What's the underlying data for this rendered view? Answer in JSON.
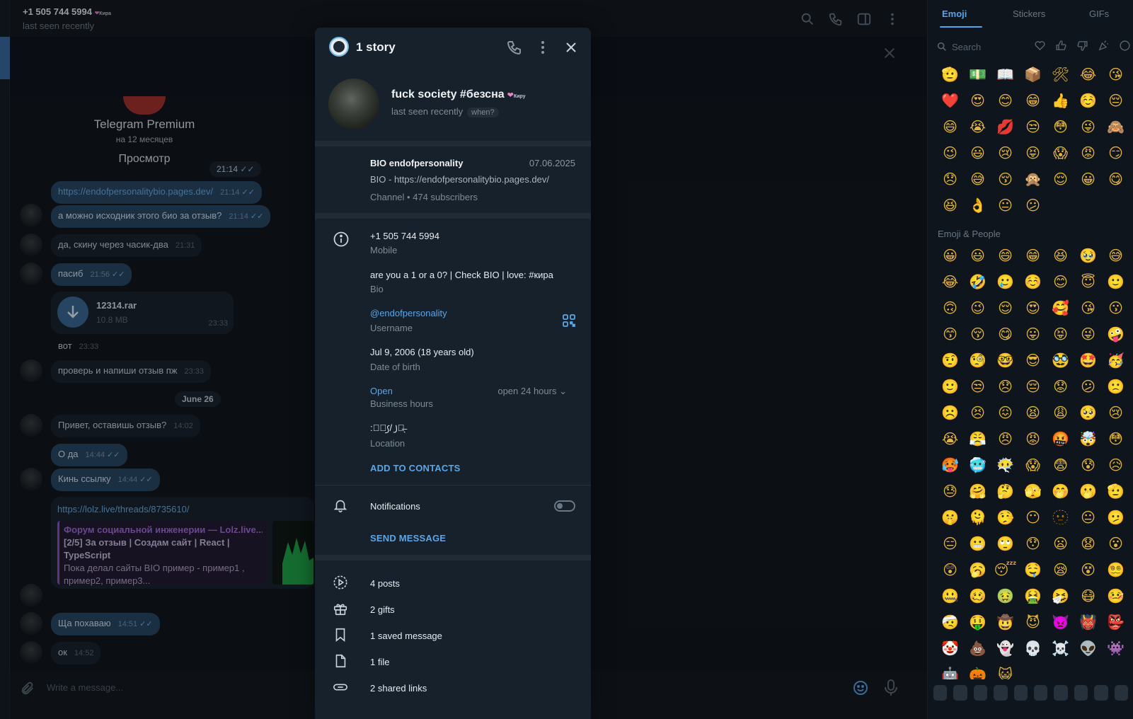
{
  "chat_header": {
    "name": "+1 505 744 5994",
    "heart_text": "Кира",
    "status": "last seen recently"
  },
  "premium": {
    "title": "Telegram Premium",
    "duration": "на 12 месяцев",
    "view": "Просмотр",
    "time": "21:14"
  },
  "messages": [
    {
      "text": "https://endofpersonalitybio.pages.dev/",
      "time": "21:14",
      "dir": "out"
    },
    {
      "text": "а можно исходник этого био за отзыв?",
      "time": "21:14",
      "dir": "out"
    },
    {
      "text": "да, скину через часик-два",
      "time": "21:31",
      "dir": "in"
    },
    {
      "text": "пасиб",
      "time": "21:56",
      "dir": "out"
    },
    {
      "text": "вот",
      "time": "23:33",
      "dir": "in"
    },
    {
      "text": "проверь и напиши отзыв пж",
      "time": "23:33",
      "dir": "in"
    },
    {
      "text": "Привет, оставишь отзыв?",
      "time": "14:02",
      "dir": "in"
    },
    {
      "text": "О да",
      "time": "14:44",
      "dir": "out"
    },
    {
      "text": "Кинь ссылку",
      "time": "14:44",
      "dir": "out"
    },
    {
      "text": "Ща похаваю",
      "time": "14:51",
      "dir": "out"
    },
    {
      "text": "ок",
      "time": "14:52",
      "dir": "in"
    }
  ],
  "file": {
    "name": "12314.rar",
    "size": "10.8 MB",
    "time": "23:33"
  },
  "date_separator": "June 26",
  "link_card": {
    "url": "https://lolz.live/threads/8735610/",
    "title": "Форум социальной инженерии — Lolz.live...",
    "desc_bold": "[2/5] За отзыв | Создам сайт | React | TypeScript",
    "desc": "Пока делал сайты BIO пример - пример1 , пример2, пример3..."
  },
  "composer": {
    "placeholder": "Write a message..."
  },
  "emoji_panel": {
    "tabs": [
      "Emoji",
      "Stickers",
      "GIFs"
    ],
    "search_placeholder": "Search",
    "section": "Emoji & People",
    "recent": [
      "🫡",
      "💵",
      "📖",
      "📦",
      "🛠",
      "😂",
      "😘",
      "❤️",
      "😍",
      "😊",
      "😁",
      "👍",
      "☺️",
      "😔",
      "😄",
      "😭",
      "💋",
      "😒",
      "😳",
      "😜",
      "🙈",
      "😉",
      "😃",
      "😢",
      "😝",
      "😱",
      "😡",
      "😏",
      "😞",
      "😅",
      "😚",
      "🙊",
      "😌",
      "😀",
      "😋",
      "😆",
      "👌",
      "😐",
      "😕"
    ],
    "people": [
      "😀",
      "😃",
      "😄",
      "😁",
      "😆",
      "🥹",
      "😅",
      "😂",
      "🤣",
      "🥲",
      "☺️",
      "😊",
      "😇",
      "🙂",
      "🙃",
      "😉",
      "😌",
      "😍",
      "🥰",
      "😘",
      "😗",
      "😙",
      "😚",
      "😋",
      "😛",
      "😝",
      "😜",
      "🤪",
      "🤨",
      "🧐",
      "🤓",
      "😎",
      "🥸",
      "🤩",
      "🥳",
      "🙂",
      "😒",
      "😞",
      "😔",
      "😟",
      "😕",
      "🙁",
      "☹️",
      "😣",
      "😖",
      "😫",
      "😩",
      "🥺",
      "😢",
      "😭",
      "😤",
      "😠",
      "😡",
      "🤬",
      "🤯",
      "😳",
      "🥵",
      "🥶",
      "😶‍🌫️",
      "😱",
      "😨",
      "😰",
      "😥",
      "😓",
      "🤗",
      "🤔",
      "🫣",
      "🤭",
      "🫢",
      "🫡",
      "🤫",
      "🫠",
      "🤥",
      "😶",
      "🫥",
      "😐",
      "🫤",
      "😑",
      "😬",
      "🙄",
      "😯",
      "😦",
      "😧",
      "😮",
      "😲",
      "🥱",
      "😴",
      "🤤",
      "😪",
      "😵",
      "😵‍💫",
      "🤐",
      "🥴",
      "🤢",
      "🤮",
      "🤧",
      "😷",
      "🤒",
      "🤕",
      "🤑",
      "🤠",
      "😈",
      "👿",
      "👹",
      "👺",
      "🤡",
      "💩",
      "👻",
      "💀",
      "☠️",
      "👽",
      "👾",
      "🤖",
      "🎃",
      "😺"
    ]
  },
  "profile": {
    "header_title": "1 story",
    "name": "fuck society #безсна",
    "heart_text": "Киру",
    "status": "last seen recently",
    "when_label": "when?",
    "channel": {
      "name": "BIO endofpersonality",
      "date": "07.06.2025",
      "desc": "BIO - https://endofpersonalitybio.pages.dev/",
      "subs": "Channel • 474 subscribers"
    },
    "phone": {
      "value": "+1 505 744 5994",
      "label": "Mobile"
    },
    "bio": {
      "value": "are you a 1 or a 0? | Check BIO | love: #кира",
      "label": "Bio"
    },
    "username": {
      "value": "@endofpersonality",
      "label": "Username"
    },
    "birth": {
      "value": "Jul 9, 2006 (18 years old)",
      "label": "Date of birth"
    },
    "hours": {
      "value": "Open",
      "label": "Business hours",
      "detail": "open 24 hours"
    },
    "location": {
      "value": ":꠹⃪꠹/ ꠸꠹̶̖",
      "label": "Location"
    },
    "add_contacts": "ADD TO CONTACTS",
    "notifications": "Notifications",
    "send_message": "SEND MESSAGE",
    "stats": [
      "4 posts",
      "2 gifts",
      "1 saved message",
      "1 file",
      "2 shared links"
    ]
  },
  "colors": {
    "accent": "#5ba6e6",
    "modal_bg": "#17212b",
    "outgoing": "#2a4968"
  }
}
